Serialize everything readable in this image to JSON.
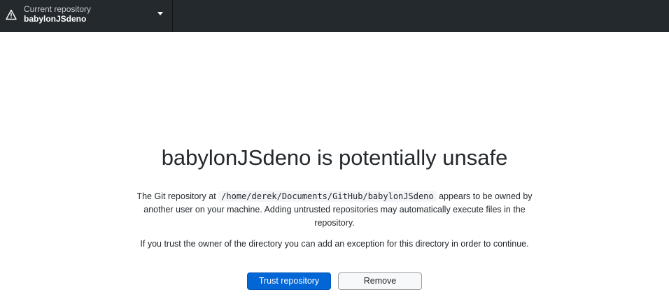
{
  "toolbar": {
    "repo_label": "Current repository",
    "repo_name": "babylonJSdeno",
    "warning_icon": "alert-triangle-icon",
    "dropdown_icon": "triangle-down-icon"
  },
  "main": {
    "title": "babylonJSdeno is potentially unsafe",
    "paragraph1": {
      "before": "The Git repository at ",
      "path": "/home/derek/Documents/GitHub/babylonJSdeno",
      "after_line1": " appears to be owned by",
      "line2": "another user on your machine. Adding untrusted repositories may automatically execute files in the",
      "line3": "repository."
    },
    "paragraph2": "If you trust the owner of the directory you can add an exception for this directory in order to continue.",
    "trust_button": "Trust repository",
    "remove_button": "Remove"
  },
  "colors": {
    "toolbar_bg": "#24292e",
    "primary": "#0366d6"
  }
}
